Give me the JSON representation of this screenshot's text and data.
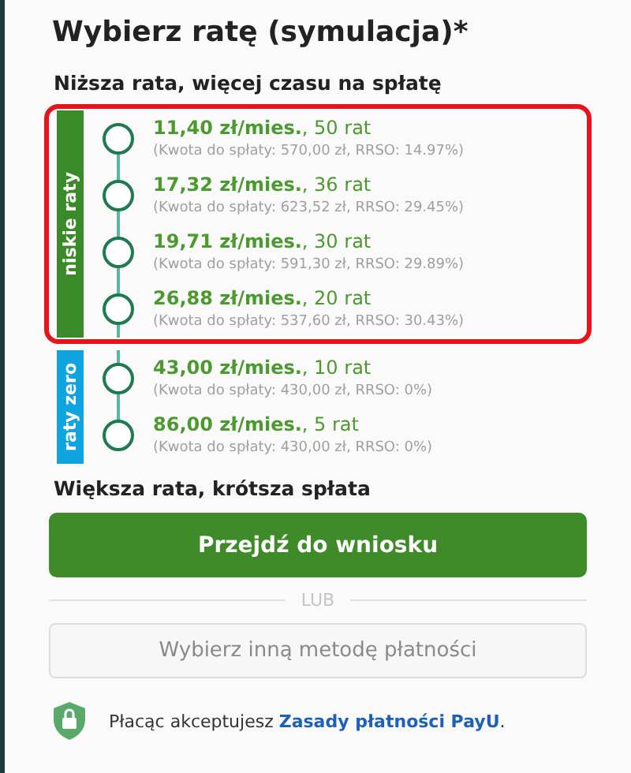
{
  "title": "Wybierz ratę (symulacja)*",
  "top_label": "Niższa rata, więcej czasu na spłatę",
  "groups": [
    {
      "label": "niskie raty",
      "kind": "low",
      "highlighted": true,
      "options": [
        {
          "amount": "11,40 zł/mies.",
          "count": ", 50 rat",
          "details": "(Kwota do spłaty: 570,00 zł, RRSO: 14.97%)",
          "selected": false
        },
        {
          "amount": "17,32 zł/mies.",
          "count": ", 36 rat",
          "details": "(Kwota do spłaty: 623,52 zł, RRSO: 29.45%)",
          "selected": false
        },
        {
          "amount": "19,71 zł/mies.",
          "count": ", 30 rat",
          "details": "(Kwota do spłaty: 591,30 zł, RRSO: 29.89%)",
          "selected": false
        },
        {
          "amount": "26,88 zł/mies.",
          "count": ", 20 rat",
          "details": "(Kwota do spłaty: 537,60 zł, RRSO: 30.43%)",
          "selected": false
        }
      ]
    },
    {
      "label": "raty zero",
      "kind": "zero",
      "highlighted": false,
      "options": [
        {
          "amount": "43,00 zł/mies.",
          "count": ", 10 rat",
          "details": "(Kwota do spłaty: 430,00 zł, RRSO: 0%)",
          "selected": false
        },
        {
          "amount": "86,00 zł/mies.",
          "count": ", 5 rat",
          "details": "(Kwota do spłaty: 430,00 zł, RRSO: 0%)",
          "selected": false
        }
      ]
    }
  ],
  "bottom_label": "Większa rata, krótsza spłata",
  "primary_button": "Przejdź do wniosku",
  "separator": "LUB",
  "secondary_button": "Wybierz inną metodę płatności",
  "footer": {
    "text": "Płacąc akceptujesz ",
    "link": "Zasady płatności PayU",
    "suffix": "."
  }
}
